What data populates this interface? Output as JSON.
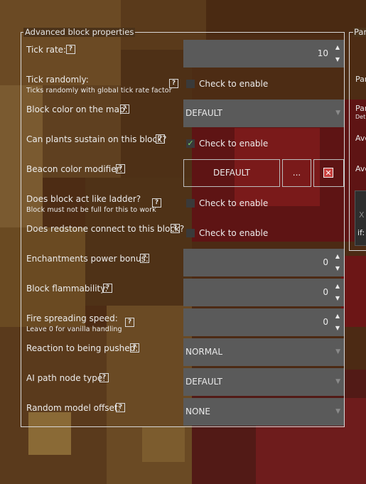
{
  "panel": {
    "title": "Advanced block properties"
  },
  "side_panel": {
    "title": "Par",
    "texts": [
      "Par",
      "Par",
      "Det",
      "Ave",
      "Ave",
      "X",
      "if:"
    ]
  },
  "rows": {
    "tick_rate": {
      "label": "Tick rate:",
      "value": "10"
    },
    "tick_randomly": {
      "label": "Tick randomly:",
      "sub": "Ticks randomly with global tick rate factor",
      "checkbox_label": "Check to enable",
      "checked": false
    },
    "map_color": {
      "label": "Block color on the map:",
      "value": "DEFAULT"
    },
    "plants_sustain": {
      "label": "Can plants sustain on this block?",
      "checkbox_label": "Check to enable",
      "checked": true
    },
    "beacon_color": {
      "label": "Beacon color modifier:",
      "value_button": "DEFAULT",
      "pick_button": "..."
    },
    "ladder": {
      "label": "Does block act like ladder?",
      "sub": "Block must not be full for this to work",
      "checkbox_label": "Check to enable",
      "checked": false
    },
    "redstone": {
      "label": "Does redstone connect to this block?",
      "checkbox_label": "Check to enable",
      "checked": false
    },
    "enchant_power": {
      "label": "Enchantments power bonus:",
      "value": "0"
    },
    "flammability": {
      "label": "Block flammability:",
      "value": "0"
    },
    "fire_spread": {
      "label": "Fire spreading speed:",
      "sub": "Leave 0 for vanilla handling",
      "value": "0"
    },
    "push_reaction": {
      "label": "Reaction to being pushed:",
      "value": "NORMAL"
    },
    "ai_path": {
      "label": "AI path node type:",
      "value": "DEFAULT"
    },
    "model_offset": {
      "label": "Random model offset:",
      "value": "NONE"
    }
  },
  "icons": {
    "help": "?",
    "spin_up": "▲",
    "spin_down": "▼",
    "combo": "▼",
    "check": "✓",
    "clear": "✕"
  },
  "colors": {
    "field_bg": "#5a5a5a",
    "checkbox_check": "#7adb6e",
    "clear_button": "#c9403e"
  }
}
